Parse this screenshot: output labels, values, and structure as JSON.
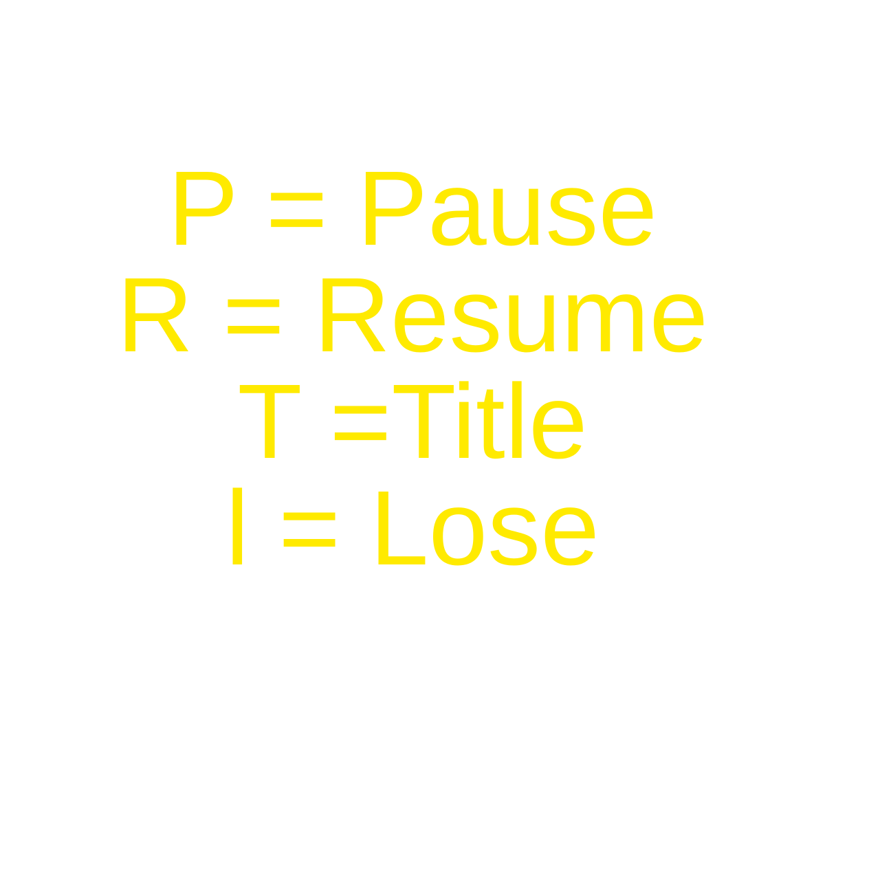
{
  "colors": {
    "background": "#ffffff",
    "text": "#ffea00"
  },
  "controls": {
    "lines": [
      "P = Pause",
      "R = Resume",
      "T =Title",
      "l = Lose"
    ]
  }
}
